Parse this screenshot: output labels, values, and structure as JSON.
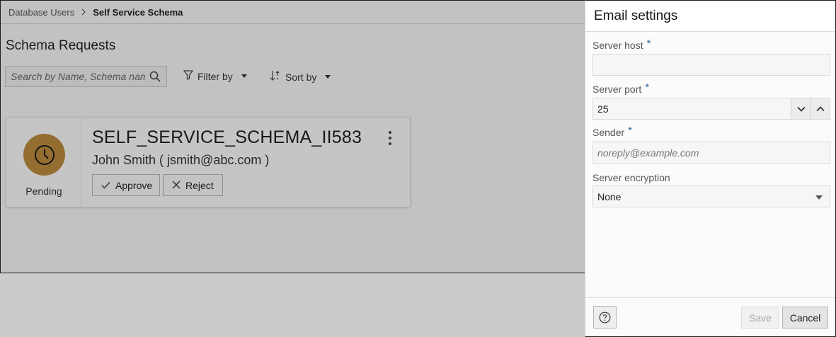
{
  "breadcrumb": {
    "parent": "Database Users",
    "current": "Self Service Schema",
    "separator_icon": "chevron-right-icon"
  },
  "page": {
    "title": "Schema Requests",
    "search_placeholder": "Search by Name, Schema name",
    "filter_label": "Filter by",
    "sort_label": "Sort by"
  },
  "request_card": {
    "schema_name": "SELF_SERVICE_SCHEMA_II583",
    "requester": "John Smith ( jsmith@abc.com )",
    "status": "Pending",
    "status_icon": "clock-icon",
    "status_color": "#b98a3c",
    "approve_label": "Approve",
    "reject_label": "Reject"
  },
  "email_settings": {
    "title": "Email settings",
    "server_host": {
      "label": "Server host",
      "required_mark": "*",
      "value": ""
    },
    "server_port": {
      "label": "Server port",
      "required_mark": "*",
      "value": "25"
    },
    "sender": {
      "label": "Sender",
      "required_mark": "*",
      "value": "",
      "placeholder": "noreply@example.com"
    },
    "server_encryption": {
      "label": "Server encryption",
      "selected": "None"
    },
    "save_label": "Save",
    "cancel_label": "Cancel",
    "required_color": "#2b6ba6"
  }
}
